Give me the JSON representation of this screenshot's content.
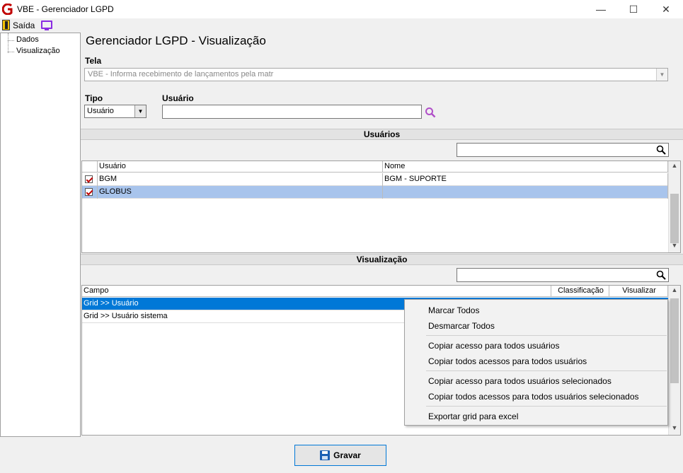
{
  "window": {
    "title": "VBE - Gerenciador LGPD",
    "minimize": "—",
    "maximize": "☐",
    "close": "✕"
  },
  "toolbar": {
    "exit_label": "Saída"
  },
  "tree": {
    "items": [
      {
        "label": "Dados"
      },
      {
        "label": "Visualização"
      }
    ]
  },
  "page": {
    "heading": "Gerenciador LGPD - Visualização",
    "tela_label": "Tela",
    "tela_value": "VBE - Informa recebimento de lançamentos pela matr",
    "tipo_label": "Tipo",
    "tipo_value": "Usuário",
    "usuario_label": "Usuário",
    "usuario_value": ""
  },
  "usuarios": {
    "section_title": "Usuários",
    "filter_value": "",
    "columns": [
      "Usuário",
      "Nome"
    ],
    "rows": [
      {
        "usuario": "BGM",
        "nome": "BGM - SUPORTE",
        "checked": true,
        "selected": false
      },
      {
        "usuario": "GLOBUS",
        "nome": "",
        "checked": true,
        "selected": true
      }
    ]
  },
  "visualizacao": {
    "section_title": "Visualização",
    "filter_value": "",
    "columns": [
      "Campo",
      "Classificação",
      "Visualizar"
    ],
    "rows": [
      {
        "campo": "Grid >> Usuário",
        "selected": true
      },
      {
        "campo": "Grid >> Usuário sistema",
        "selected": false
      }
    ]
  },
  "context_menu": {
    "items": [
      "Marcar Todos",
      "Desmarcar Todos",
      "Copiar acesso para todos usuários",
      "Copiar todos acessos para todos usuários",
      "Copiar acesso para todos usuários selecionados",
      "Copiar todos acessos para todos usuários selecionados",
      "Exportar grid para excel"
    ]
  },
  "footer": {
    "save_label": "Gravar"
  },
  "colors": {
    "selected_row": "#a8c4ec",
    "focus_row": "#0078d7",
    "section_bar": "#e3e3e3",
    "accent_purple": "#8a2be2",
    "brand_red": "#c00000"
  }
}
